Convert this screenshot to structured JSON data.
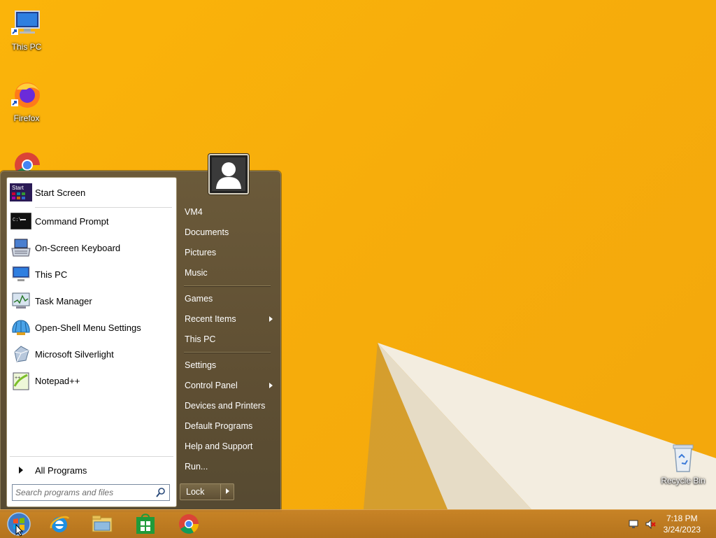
{
  "desktop": {
    "icons": [
      {
        "label": "This PC",
        "icon": "this-pc-icon"
      },
      {
        "label": "Firefox",
        "icon": "firefox-icon"
      },
      {
        "label": "Chrome",
        "icon": "chrome-icon"
      },
      {
        "label": "Recycle Bin",
        "icon": "recycle-bin-icon"
      }
    ]
  },
  "start_menu": {
    "pinned": [
      {
        "label": "Start Screen",
        "icon": "start-screen-icon"
      },
      {
        "label": "Command Prompt",
        "icon": "command-prompt-icon"
      },
      {
        "label": "On-Screen Keyboard",
        "icon": "keyboard-icon"
      },
      {
        "label": "This PC",
        "icon": "this-pc-icon"
      },
      {
        "label": "Task Manager",
        "icon": "task-manager-icon"
      },
      {
        "label": "Open-Shell Menu Settings",
        "icon": "shell-icon"
      },
      {
        "label": "Microsoft Silverlight",
        "icon": "silverlight-icon"
      },
      {
        "label": "Notepad++",
        "icon": "notepadpp-icon"
      }
    ],
    "start_tile_text": "Start",
    "all_programs": "All Programs",
    "search_placeholder": "Search programs and files",
    "right": {
      "user": "VM4",
      "documents": "Documents",
      "pictures": "Pictures",
      "music": "Music",
      "games": "Games",
      "recent_items": "Recent Items",
      "this_pc": "This PC",
      "settings": "Settings",
      "control_panel": "Control Panel",
      "devices_printers": "Devices and Printers",
      "default_programs": "Default Programs",
      "help_support": "Help and Support",
      "run": "Run..."
    },
    "lock_label": "Lock"
  },
  "taskbar": {
    "apps": [
      "start-orb-icon",
      "internet-explorer-icon",
      "file-explorer-icon",
      "store-icon",
      "chrome-icon"
    ],
    "time": "7:18 PM",
    "date": "3/24/2023"
  },
  "colors": {
    "wallpaper": "#f7ad0b",
    "menu": "#5f4f33",
    "taskbar": "#c48028"
  }
}
